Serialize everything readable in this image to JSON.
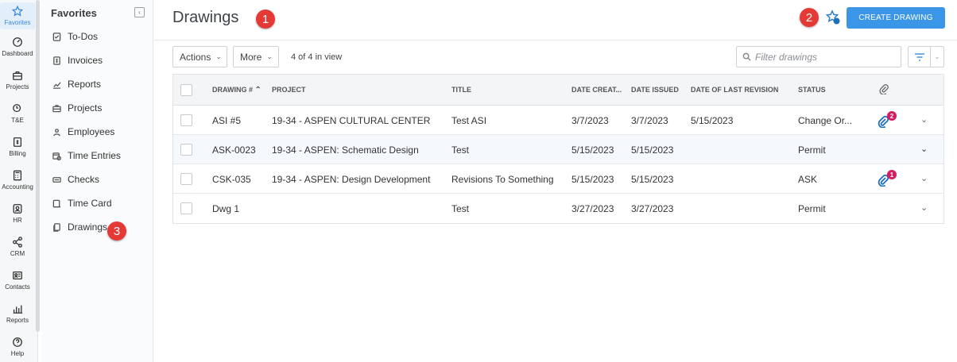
{
  "rail": {
    "items": [
      {
        "label": "Favorites",
        "icon": "star-icon"
      },
      {
        "label": "Dashboard",
        "icon": "dashboard-icon"
      },
      {
        "label": "Projects",
        "icon": "briefcase-icon"
      },
      {
        "label": "T&E",
        "icon": "clock-dollar-icon"
      },
      {
        "label": "Billing",
        "icon": "billing-icon"
      },
      {
        "label": "Accounting",
        "icon": "calculator-icon"
      },
      {
        "label": "HR",
        "icon": "person-badge-icon"
      },
      {
        "label": "CRM",
        "icon": "network-icon"
      },
      {
        "label": "Contacts",
        "icon": "contact-card-icon"
      },
      {
        "label": "Reports",
        "icon": "bar-chart-icon"
      },
      {
        "label": "Help",
        "icon": "help-icon"
      }
    ]
  },
  "favorites": {
    "title": "Favorites",
    "items": [
      {
        "label": "To-Dos",
        "icon": "todo-icon"
      },
      {
        "label": "Invoices",
        "icon": "invoice-icon"
      },
      {
        "label": "Reports",
        "icon": "chart-icon"
      },
      {
        "label": "Projects",
        "icon": "briefcase-icon"
      },
      {
        "label": "Employees",
        "icon": "people-icon"
      },
      {
        "label": "Time Entries",
        "icon": "calendar-clock-icon"
      },
      {
        "label": "Checks",
        "icon": "check-icon"
      },
      {
        "label": "Time Card",
        "icon": "timecard-icon"
      },
      {
        "label": "Drawings",
        "icon": "drawings-icon"
      }
    ]
  },
  "markers": {
    "m1": "1",
    "m2": "2",
    "m3": "3"
  },
  "header": {
    "title": "Drawings",
    "create_label": "CREATE DRAWING"
  },
  "toolbar": {
    "actions_label": "Actions",
    "more_label": "More",
    "count_text": "4 of 4 in view",
    "filter_placeholder": "Filter drawings"
  },
  "table": {
    "columns": {
      "drawing": "DRAWING #",
      "project": "PROJECT",
      "title": "TITLE",
      "date_created": "DATE CREAT...",
      "date_issued": "DATE ISSUED",
      "date_revision": "DATE OF LAST REVISION",
      "status": "STATUS"
    },
    "rows": [
      {
        "drawing": "ASI #5",
        "project": "19-34 - ASPEN CULTURAL CENTER",
        "title": "Test ASI",
        "date_created": "3/7/2023",
        "date_issued": "3/7/2023",
        "date_revision": "5/15/2023",
        "status": "Change Or...",
        "attachments": "2"
      },
      {
        "drawing": "ASK-0023",
        "project": "19-34 - ASPEN: Schematic Design",
        "title": "Test",
        "date_created": "5/15/2023",
        "date_issued": "5/15/2023",
        "date_revision": "",
        "status": "Permit",
        "attachments": ""
      },
      {
        "drawing": "CSK-035",
        "project": "19-34 - ASPEN: Design Development",
        "title": "Revisions To Something",
        "date_created": "5/15/2023",
        "date_issued": "5/15/2023",
        "date_revision": "",
        "status": "ASK",
        "attachments": "1"
      },
      {
        "drawing": "Dwg 1",
        "project": "",
        "title": "Test",
        "date_created": "3/27/2023",
        "date_issued": "3/27/2023",
        "date_revision": "",
        "status": "Permit",
        "attachments": ""
      }
    ]
  },
  "colors": {
    "accent": "#3b96e8",
    "marker": "#e53935",
    "badge": "#d81b60"
  }
}
